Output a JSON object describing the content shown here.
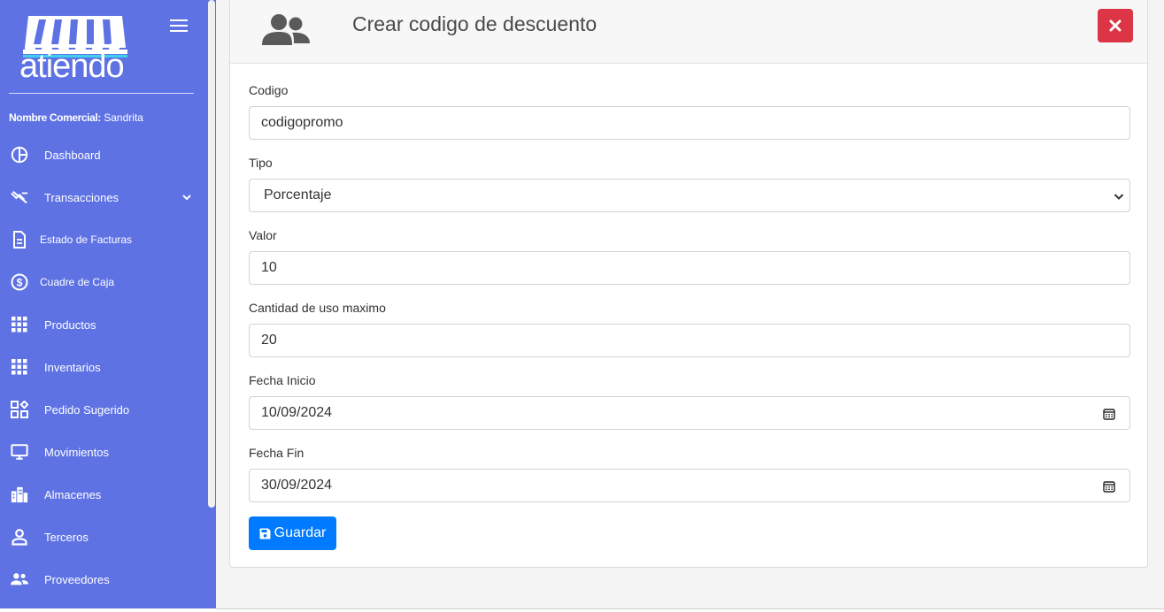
{
  "brand": {
    "name": "atiendo"
  },
  "sidebar": {
    "commercial_label": "Nombre Comercial:",
    "commercial_value": "Sandrita",
    "items": [
      {
        "label": "Dashboard",
        "icon": "pie-chart-icon"
      },
      {
        "label": "Transacciones",
        "icon": "transactions-icon",
        "expandable": true
      },
      {
        "label": "Estado de Facturas",
        "icon": "document-icon"
      },
      {
        "label": "Cuadre de Caja",
        "icon": "dollar-circle-icon"
      },
      {
        "label": "Productos",
        "icon": "grid-icon"
      },
      {
        "label": "Inventarios",
        "icon": "grid-icon"
      },
      {
        "label": "Pedido Sugerido",
        "icon": "widgets-icon"
      },
      {
        "label": "Movimientos",
        "icon": "monitor-icon"
      },
      {
        "label": "Almacenes",
        "icon": "buildings-icon"
      },
      {
        "label": "Terceros",
        "icon": "person-icon"
      },
      {
        "label": "Proveedores",
        "icon": "people-icon"
      }
    ]
  },
  "form": {
    "title": "Crear codigo de descuento",
    "fields": {
      "codigo": {
        "label": "Codigo",
        "value": "codigopromo"
      },
      "tipo": {
        "label": "Tipo",
        "value": "Porcentaje"
      },
      "valor": {
        "label": "Valor",
        "value": "10"
      },
      "cantidad": {
        "label": "Cantidad de uso maximo",
        "value": "20"
      },
      "fecha_inicio": {
        "label": "Fecha Inicio",
        "value": "10/09/2024"
      },
      "fecha_fin": {
        "label": "Fecha Fin",
        "value": "30/09/2024"
      }
    },
    "save_label": "Guardar"
  },
  "colors": {
    "sidebar": "#5e72e4",
    "danger": "#dc3545",
    "primary": "#007bff"
  }
}
